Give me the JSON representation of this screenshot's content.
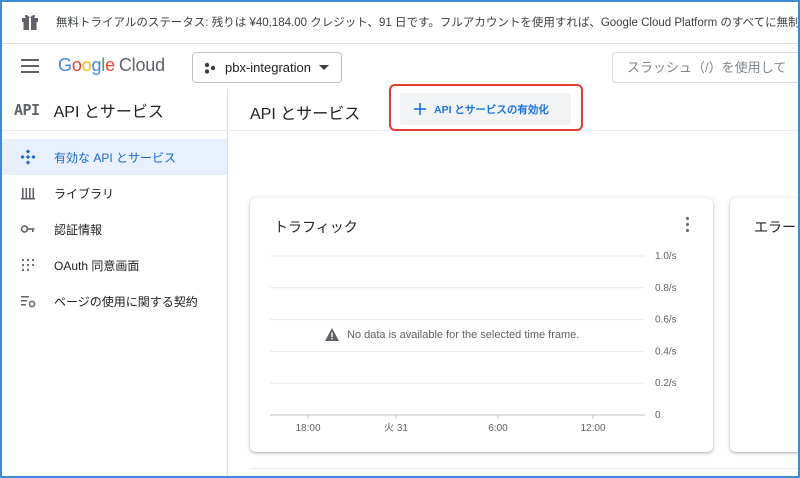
{
  "banner": {
    "message": "無料トライアルのステータス: 残りは ¥40,184.00 クレジット、91 日です。フルアカウントを使用すれば、Google Cloud Platform のすべてに無制限でアクセ"
  },
  "header": {
    "logo_google": "Google",
    "logo_cloud": "Cloud",
    "project": "pbx-integration",
    "search_placeholder": "スラッシュ（/）を使用して"
  },
  "sidebar": {
    "api_mark": "API",
    "title": "API とサービス",
    "items": [
      {
        "label": "有効な API とサービス",
        "icon": "api-diamond-icon",
        "active": true
      },
      {
        "label": "ライブラリ",
        "icon": "library-icon",
        "active": false
      },
      {
        "label": "認証情報",
        "icon": "key-icon",
        "active": false
      },
      {
        "label": "OAuth 同意画面",
        "icon": "consent-grid-icon",
        "active": false
      },
      {
        "label": "ページの使用に関する契約",
        "icon": "settings-list-icon",
        "active": false
      }
    ]
  },
  "main": {
    "title": "API とサービス",
    "enable_button": "API とサービスの有効化"
  },
  "cards": {
    "traffic": {
      "title": "トラフィック",
      "no_data": "No data is available for the selected time frame."
    },
    "errors": {
      "title": "エラー"
    }
  },
  "chart_data": {
    "type": "line",
    "title": "トラフィック",
    "x_ticks": [
      "18:00",
      "火 31",
      "6:00",
      "12:00"
    ],
    "y_ticks": [
      "1.0/s",
      "0.8/s",
      "0.6/s",
      "0.4/s",
      "0.2/s",
      "0"
    ],
    "ylim": [
      0,
      1.0
    ],
    "series": [],
    "grid": true
  },
  "colors": {
    "accent": "#1a73e8",
    "active_bg": "#e8f0fe",
    "highlight": "#e53935"
  }
}
